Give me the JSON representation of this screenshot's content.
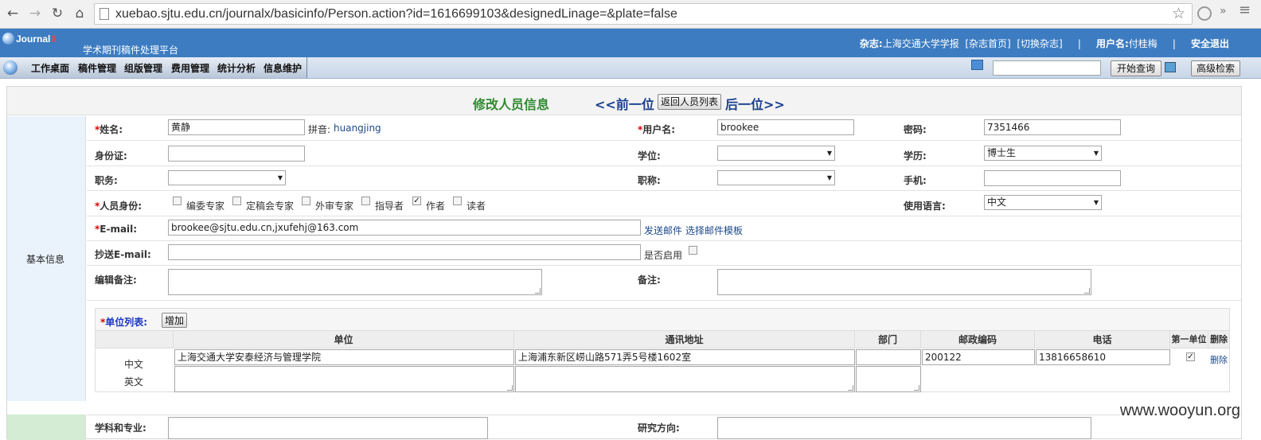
{
  "browser": {
    "url": "xuebao.sjtu.edu.cn/journalx/basicinfo/Person.action?id=1616699103&designedLinage=&plate=false"
  },
  "header": {
    "logo_text": "Journal",
    "logo_x": "X",
    "subtitle": "学术期刊稿件处理平台",
    "journal_label": "杂志:",
    "journal_name": "上海交通大学学报",
    "home_link": "[杂志首页]",
    "switch_link": "[切换杂志]",
    "sep": "|",
    "user_label": "用户名:",
    "user_name": "付桂梅",
    "logout": "安全退出"
  },
  "menu": {
    "items": [
      "工作桌面",
      "稿件管理",
      "组版管理",
      "费用管理",
      "统计分析",
      "信息维护"
    ],
    "search_button": "开始查询",
    "advanced_button": "高级检索"
  },
  "page": {
    "title": "修改人员信息",
    "prev": "<<前一位",
    "back_button": "返回人员列表",
    "next": "后一位>>",
    "section_label": "基本信息"
  },
  "form": {
    "required_mark": "*",
    "name_label": "姓名:",
    "name_value": "黄静",
    "pinyin_label": "拼音:",
    "pinyin_value": "huangjing",
    "username_label": "用户名:",
    "username_value": "brookee",
    "password_label": "密码:",
    "password_value": "7351466",
    "idcard_label": "身份证:",
    "degree_label": "学位:",
    "education_label": "学历:",
    "education_value": "博士生",
    "position_label": "职务:",
    "title_label": "职称:",
    "mobile_label": "手机:",
    "role_label": "人员身份:",
    "roles": [
      {
        "label": "编委专家",
        "checked": false
      },
      {
        "label": "定稿会专家",
        "checked": false
      },
      {
        "label": "外审专家",
        "checked": false
      },
      {
        "label": "指导者",
        "checked": false
      },
      {
        "label": "作者",
        "checked": true
      },
      {
        "label": "读者",
        "checked": false
      }
    ],
    "language_label": "使用语言:",
    "language_value": "中文",
    "email_label": "E-mail:",
    "email_value": "brookee@sjtu.edu.cn,jxufehj@163.com",
    "send_mail": "发送邮件",
    "choose_template": "选择邮件模板",
    "cc_email_label": "抄送E-mail:",
    "enable_label": "是否启用",
    "editor_note_label": "编辑备注:",
    "note_label": "备注:",
    "discipline_label": "学科和专业:",
    "research_label": "研究方向:"
  },
  "units": {
    "list_label": "单位列表:",
    "add_button": "增加",
    "columns": [
      "单位",
      "通讯地址",
      "部门",
      "邮政编码",
      "电话",
      "第一单位",
      "删除"
    ],
    "lang_cn": "中文",
    "lang_en": "英文",
    "unit_cn": "上海交通大学安泰经济与管理学院",
    "address_cn": "上海浦东新区崂山路571弄5号楼1602室",
    "postcode": "200122",
    "phone": "13816658610",
    "delete_link": "删除"
  },
  "watermark": "www.wooyun.org"
}
